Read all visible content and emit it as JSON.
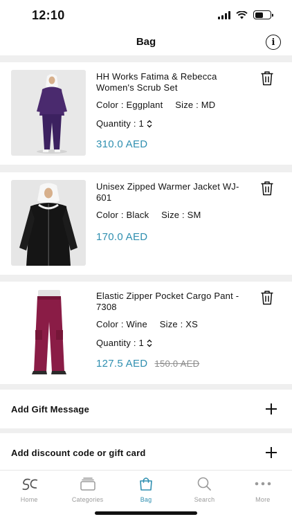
{
  "status_bar": {
    "time": "12:10"
  },
  "header": {
    "title": "Bag"
  },
  "cart": {
    "items": [
      {
        "name": "HH Works Fatima & Rebecca Women's Scrub Set",
        "color": "Color : Eggplant",
        "size": "Size : MD",
        "quantity": "Quantity : 1",
        "price": "310.0 AED"
      },
      {
        "name": "Unisex Zipped Warmer Jacket WJ-601",
        "color": "Color : Black",
        "size": "Size : SM",
        "price": "170.0 AED"
      },
      {
        "name": "Elastic Zipper Pocket Cargo Pant - 7308",
        "color": "Color : Wine",
        "size": "Size : XS",
        "quantity": "Quantity : 1",
        "price": "127.5 AED",
        "original_price": "150.0 AED"
      }
    ]
  },
  "actions": {
    "gift_message": "Add Gift Message",
    "discount": "Add discount code or gift card"
  },
  "tab_bar": {
    "tabs": [
      {
        "label": "Home",
        "icon": "logo-icon"
      },
      {
        "label": "Categories",
        "icon": "categories-icon"
      },
      {
        "label": "Bag",
        "icon": "bag-icon",
        "active": true
      },
      {
        "label": "Search",
        "icon": "search-icon"
      },
      {
        "label": "More",
        "icon": "more-icon"
      }
    ]
  },
  "colors": {
    "accent": "#2f8fb0",
    "product_1": "#4a2a6e",
    "product_2": "#151515",
    "product_3": "#8a1c46"
  }
}
